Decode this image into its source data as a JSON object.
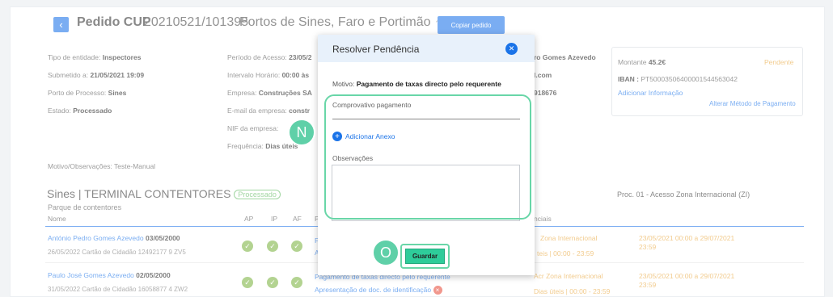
{
  "header": {
    "title_bold": "Pedido CUP",
    "title_number": "20210521/101395",
    "title_ports": "Portos de Sines, Faro e Portimão",
    "copy_button": "Copiar pedido"
  },
  "info": {
    "tipo_label": "Tipo de entidade: ",
    "tipo_value": "Inspectores",
    "submetido_label": "Submetido a: ",
    "submetido_value": "21/05/2021 19:09",
    "porto_label": "Porto de Processo: ",
    "porto_value": "Sines",
    "estado_label": "Estado: ",
    "estado_value": "Processado",
    "periodo_label": "Período de Acesso: ",
    "periodo_value": "23/05/2",
    "intervalo_label": "Intervalo Horário: ",
    "intervalo_value": "00:00 às",
    "empresa_label": "Empresa: ",
    "empresa_value": "Construções SA",
    "email_label": "E-mail da empresa: ",
    "email_value": "constr",
    "nif_label": "NIF da empresa:",
    "freq_label": "Frequência: ",
    "freq_value": "Dias úteis",
    "right_name": "ro Gomes Azevedo",
    "right_email": "l.com",
    "right_phone": "918676",
    "motivo_obs": "Motivo/Observações: Teste-Manual"
  },
  "payment": {
    "montante_label": "Montante ",
    "montante_value": "45.2€",
    "status": "Pendente",
    "iban_label": "IBAN : ",
    "iban_value": "PT50003506400001544563042",
    "add_info": "Adicionar Informação",
    "change_method": "Alterar Método de Pagamento"
  },
  "section": {
    "title": "Sines | TERMINAL CONTENTORES",
    "status": "Processado",
    "subtitle": "Parque de contentores",
    "right": "Proc. 01 - Acesso Zona Internacional (ZI)"
  },
  "table": {
    "col_name": "Nome",
    "col_ap": "AP",
    "col_ip": "IP",
    "col_af": "AF",
    "col_p": "P",
    "col_ncials": "nciais",
    "rows": [
      {
        "name": "António Pedro Gomes Azevedo",
        "date": "03/05/2000",
        "detail": "26/05/2022  Cartão de Cidadão  12492177 9 ZV5",
        "doc1": "F",
        "doc2": "A",
        "zone": "Zona Internacional",
        "zone2": "teis | 00:00 - 23:59",
        "period": "23/05/2021 00:00  a  29/07/2021",
        "time": "23:59"
      },
      {
        "name": "Paulo José Gomes Azevedo",
        "date": "02/05/2000",
        "detail": "31/05/2022  Cartão de Cidadão  16058877 4 ZW2",
        "doc1": "Pagamento de taxas directo pelo requerente",
        "doc2": "Apresentação de doc. de identificação",
        "zone": "Acr Zona Internacional",
        "zone2": "Dias úteis | 00:00 - 23:59",
        "period": "23/05/2021 00:00  a  29/07/2021",
        "time": "23:59"
      }
    ]
  },
  "modal": {
    "title": "Resolver Pendência",
    "motivo_label": "Motivo: ",
    "motivo_value": "Pagamento de taxas directo pelo requerente",
    "comprovativo_label": "Comprovativo pagamento",
    "add_attachment": "Adicionar Anexo",
    "observacoes_label": "Observações",
    "save_button": "Guardar"
  },
  "markers": {
    "n": "N",
    "o": "O"
  }
}
